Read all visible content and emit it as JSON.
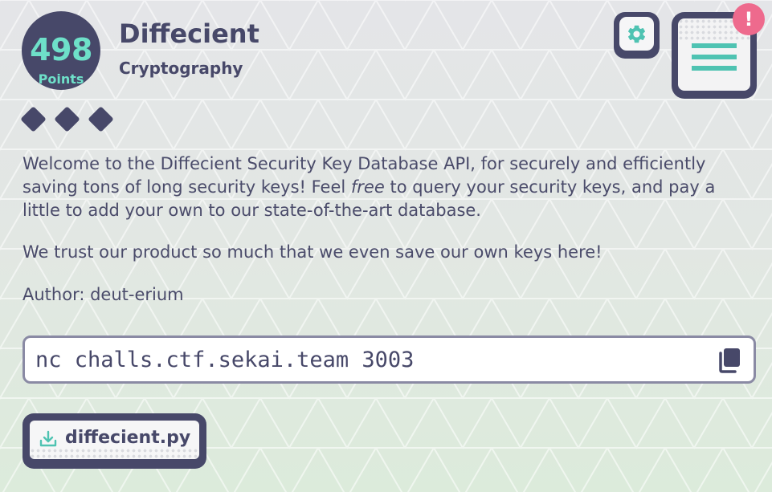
{
  "challenge": {
    "points": "498",
    "points_label": "Points",
    "title": "Diffecient",
    "category": "Cryptography",
    "difficulty_level": 3
  },
  "header": {
    "alert_badge": "!"
  },
  "description": {
    "p1_before": "Welcome to the Diffecient Security Key Database API, for securely and efficiently saving tons of long security keys! Feel ",
    "p1_emphasis": "free",
    "p1_after": " to query your security keys, and pay a little to add your own to our state-of-the-art database.",
    "p2": "We trust our product so much that we even save our own keys here!",
    "author": "Author: deut-erium"
  },
  "connection": {
    "command": "nc challs.ctf.sekai.team 3003"
  },
  "files": [
    {
      "name": "diffecient.py"
    }
  ],
  "icons": {
    "settings": "gear-icon",
    "menu": "hamburger-icon",
    "copy": "copy-icon",
    "download": "download-icon"
  },
  "colors": {
    "primary": "#474869",
    "accent": "#6ee0c9",
    "alert": "#ee6a8d",
    "border": "#8a8aa4"
  }
}
